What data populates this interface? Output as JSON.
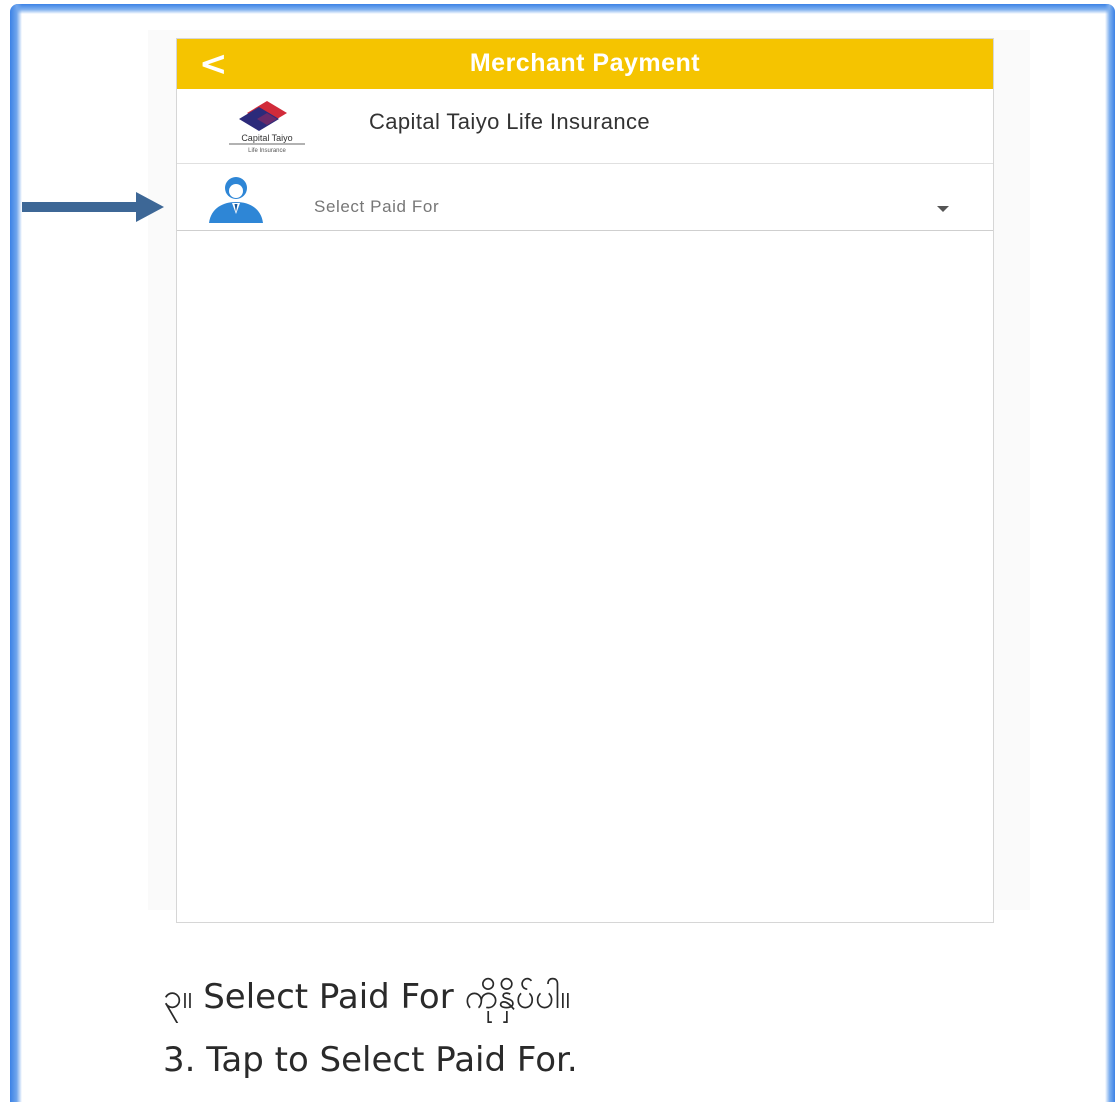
{
  "header": {
    "back_glyph": "<",
    "title": "Merchant Payment",
    "color": "#f5c400"
  },
  "merchant": {
    "name": "Capital Taiyo Life Insurance",
    "logo_text": "Capital Taiyo",
    "logo_subtext": "Life Insurance"
  },
  "select": {
    "placeholder": "Select Paid For",
    "icon": "person-icon",
    "caret_icon": "caret-down-icon"
  },
  "pointer": {
    "icon": "arrow-right-icon",
    "color": "#3d6796"
  },
  "instructions": {
    "myanmar": "၃။ Select Paid For ကိုနှိပ်ပါ။",
    "english": "3. Tap to Select Paid For."
  },
  "frame": {
    "border_color": "#3b82e6"
  }
}
